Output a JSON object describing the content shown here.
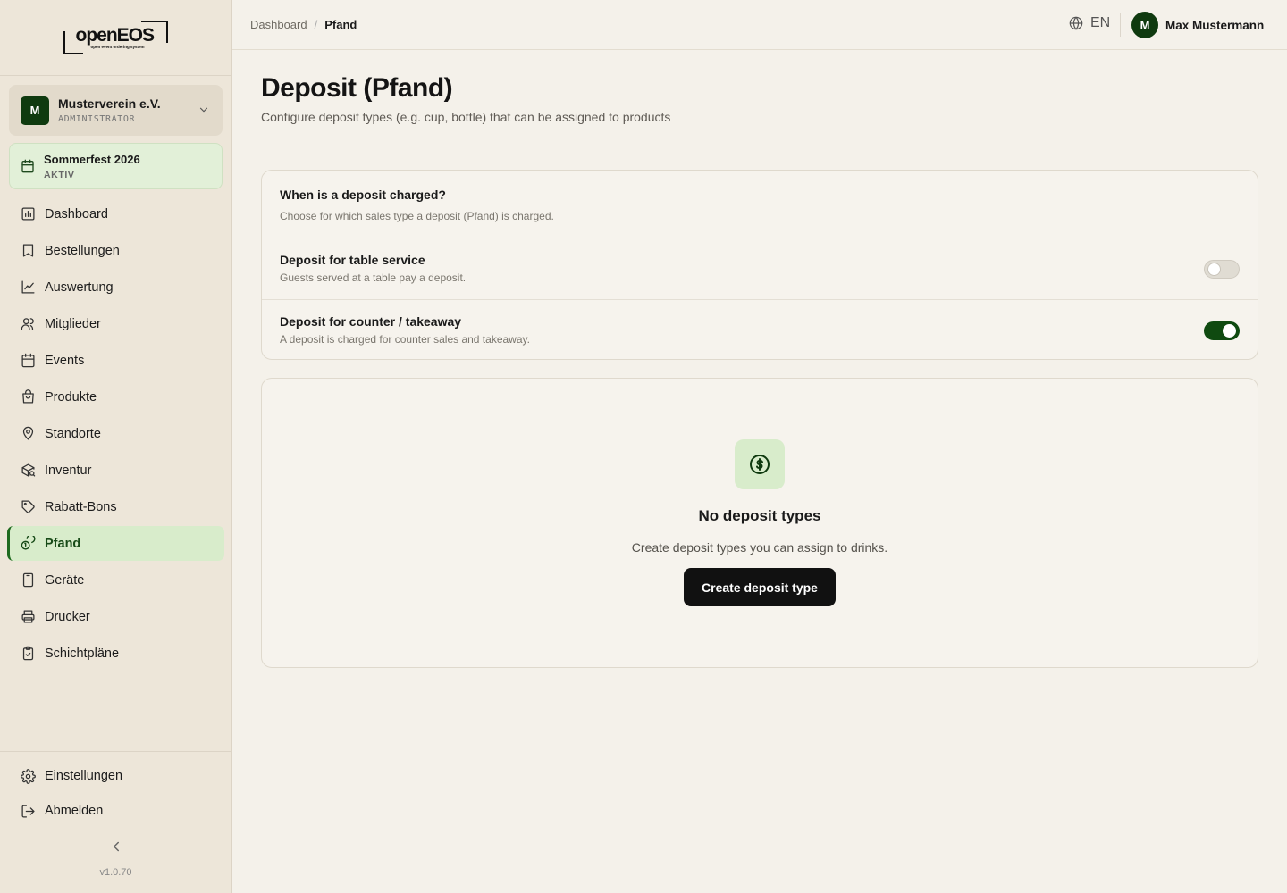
{
  "app": {
    "logo_text": "openEOS",
    "logo_tagline": "open event ordering system",
    "version": "v1.0.70"
  },
  "org": {
    "initial": "M",
    "name": "Musterverein e.V.",
    "role": "ADMINISTRATOR"
  },
  "event": {
    "name": "Sommerfest 2026",
    "status": "AKTIV"
  },
  "nav": [
    {
      "label": "Dashboard",
      "icon": "chart-icon"
    },
    {
      "label": "Bestellungen",
      "icon": "receipt-icon"
    },
    {
      "label": "Auswertung",
      "icon": "trend-icon"
    },
    {
      "label": "Mitglieder",
      "icon": "users-icon"
    },
    {
      "label": "Events",
      "icon": "calendar-icon"
    },
    {
      "label": "Produkte",
      "icon": "bag-icon"
    },
    {
      "label": "Standorte",
      "icon": "map-pin-icon"
    },
    {
      "label": "Inventur",
      "icon": "package-search-icon"
    },
    {
      "label": "Rabatt-Bons",
      "icon": "tag-icon"
    },
    {
      "label": "Pfand",
      "icon": "coins-icon",
      "active": true
    },
    {
      "label": "Geräte",
      "icon": "tablet-icon"
    },
    {
      "label": "Drucker",
      "icon": "printer-icon"
    },
    {
      "label": "Schichtpläne",
      "icon": "clipboard-check-icon"
    }
  ],
  "sidebar_bottom": {
    "settings": "Einstellungen",
    "logout": "Abmelden"
  },
  "topbar": {
    "breadcrumb_root": "Dashboard",
    "breadcrumb_sep": "/",
    "breadcrumb_current": "Pfand",
    "language": "EN",
    "user_initial": "M",
    "user_name": "Max Mustermann"
  },
  "page": {
    "title": "Deposit (Pfand)",
    "subtitle": "Configure deposit types (e.g. cup, bottle) that can be assigned to products"
  },
  "settings": {
    "title": "When is a deposit charged?",
    "description": "Choose for which sales type a deposit (Pfand) is charged.",
    "rows": [
      {
        "label": "Deposit for table service",
        "description": "Guests served at a table pay a deposit.",
        "enabled": false
      },
      {
        "label": "Deposit for counter / takeaway",
        "description": "A deposit is charged for counter sales and takeaway.",
        "enabled": true
      }
    ]
  },
  "empty_state": {
    "icon": "coin-icon",
    "title": "No deposit types",
    "description": "Create deposit types you can assign to drinks.",
    "button": "Create deposit type"
  },
  "colors": {
    "accent": "#0f3a0f",
    "active_bg": "#d8eccb",
    "background": "#f4f1ea",
    "sidebar": "#ede6d9"
  }
}
